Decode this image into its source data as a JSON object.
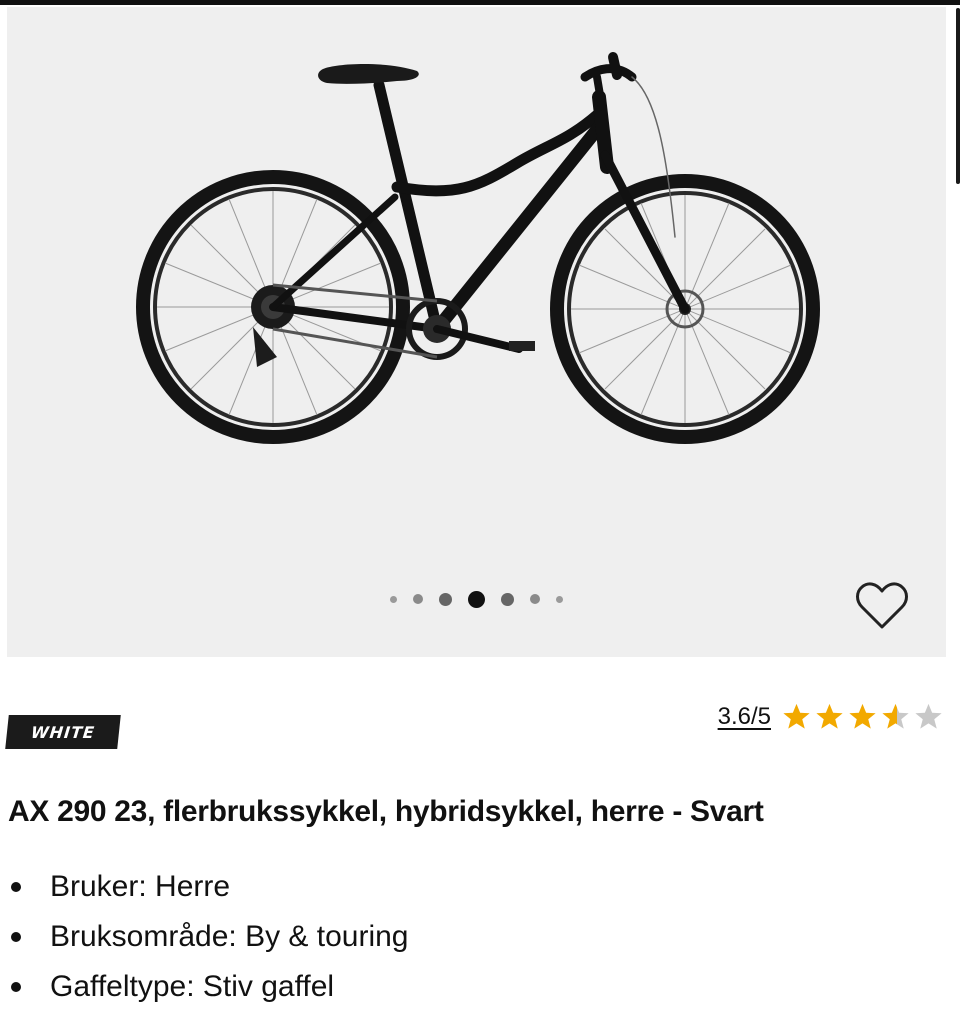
{
  "gallery": {
    "image_alt": "Svart hybridsykkel",
    "dots_count": 7,
    "active_index": 3,
    "favorite_icon": "heart-outline-icon"
  },
  "brand": {
    "logo_text": "WHITE"
  },
  "rating": {
    "value_text": "3.6/5",
    "score": 3.6,
    "max": 5,
    "star_color": "#f2a900",
    "empty_star_color": "#c8c8c8"
  },
  "product": {
    "title": "AX 290 23, flerbrukssykkel, hybridsykkel, herre - Svart"
  },
  "specs": [
    {
      "text": "Bruker: Herre"
    },
    {
      "text": "Bruksområde: By & touring"
    },
    {
      "text": "Gaffeltype: Stiv gaffel"
    }
  ]
}
